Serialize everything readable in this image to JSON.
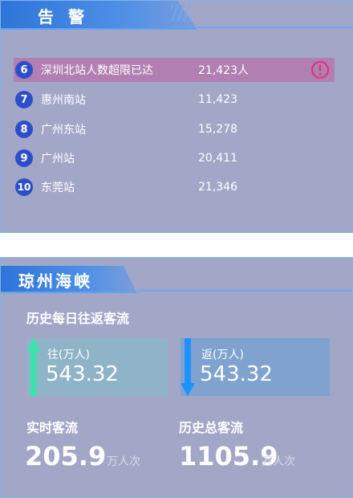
{
  "alarm": {
    "title": "告警",
    "rows": [
      {
        "rank": "6",
        "name": "深圳北站人数超限已达",
        "count": "21,423人",
        "warning": true
      },
      {
        "rank": "7",
        "name": "惠州南站",
        "count": "11,423",
        "warning": false
      },
      {
        "rank": "8",
        "name": "广州东站",
        "count": "15,278",
        "warning": false
      },
      {
        "rank": "9",
        "name": "广州站",
        "count": "20,411",
        "warning": false
      },
      {
        "rank": "10",
        "name": "东莞站",
        "count": "21,346",
        "warning": false
      }
    ]
  },
  "hainan": {
    "title": "琼州海峡",
    "daily_label": "历史每日往返客流",
    "outbound": {
      "label": "往(万人)",
      "value": "543.32"
    },
    "return": {
      "label": "返(万人)",
      "value": "543.32"
    },
    "realtime": {
      "label": "实时客流",
      "value": "205.9",
      "unit": "万人次"
    },
    "total": {
      "label": "历史总客流",
      "value": "1105.9",
      "unit": "万人次"
    }
  },
  "colors": {
    "panel": "#a2a7c8",
    "title_tab": "#2f74d9",
    "badge": "#2c4fc9",
    "highlight_row": "#b17fb2",
    "warning": "#e0307a",
    "arrow_out": "#3fe0b0",
    "arrow_back": "#1e90ff"
  }
}
